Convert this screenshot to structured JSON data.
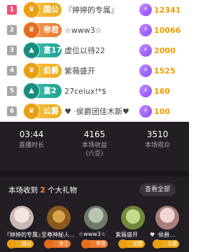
{
  "colors": {
    "gold": "#f2b829",
    "orange": "#f0893a",
    "teal": "#2db3a3",
    "score": "#f09b00",
    "rank1": "#f4507a",
    "rank_other": "#a6a6a6",
    "panel_bg": "#231d24",
    "highlight": "#ff8a2b"
  },
  "rank_list": [
    {
      "rank": "1",
      "badge": "国公",
      "badge_color": "gold",
      "icon": "crown-icon",
      "name": "『婷婷的专属』",
      "score_icon": "lightning-icon",
      "score": "12341"
    },
    {
      "rank": "2",
      "badge": "帝君",
      "badge_color": "orange",
      "icon": "crown-icon",
      "name": "☆www3☆",
      "score_icon": "lightning-icon",
      "score": "10066"
    },
    {
      "rank": "3",
      "badge": "富17",
      "badge_color": "teal",
      "icon": "up-arrow-icon",
      "name": "虚位以待22",
      "score_icon": "lightning-icon",
      "score": "2000"
    },
    {
      "rank": "4",
      "badge": "伯爵",
      "badge_color": "gold",
      "icon": "crown-icon",
      "name": "紫薇盛开",
      "score_icon": "lightning-icon",
      "score": "1525"
    },
    {
      "rank": "5",
      "badge": "富2",
      "badge_color": "teal",
      "icon": "up-arrow-icon",
      "name": "27ceiux!*$",
      "score_icon": "lightning-icon",
      "score": "160"
    },
    {
      "rank": "6",
      "badge": "公爵",
      "badge_color": "gold",
      "icon": "crown-icon",
      "name": "♥ ·侯爵团佳木斯♥",
      "score_icon": "lightning-icon",
      "score": "100"
    }
  ],
  "stats": [
    {
      "value": "03:44",
      "label": "直播时长"
    },
    {
      "value": "4165",
      "label": "本场收益",
      "sublabel": "(六豆)"
    },
    {
      "value": "3510",
      "label": "本场观众"
    }
  ],
  "gifts": {
    "title_prefix": "本场收到",
    "count": "2",
    "title_suffix": "个大礼物",
    "view_all": "查看全部",
    "items": [
      {
        "name": "『婷婷的专属』",
        "badge": "国公",
        "badge_color": "gold"
      },
      {
        "name": "至尊神秘人…",
        "badge": "帝王",
        "badge_color": "orange"
      },
      {
        "name": "☆www3☆",
        "badge": "帝君",
        "badge_color": "orange"
      },
      {
        "name": "紫薇盛开",
        "badge": "伯爵",
        "badge_color": "gold"
      },
      {
        "name": "♥ ·侯爵…",
        "badge": "公爵",
        "badge_color": "gold"
      }
    ]
  }
}
